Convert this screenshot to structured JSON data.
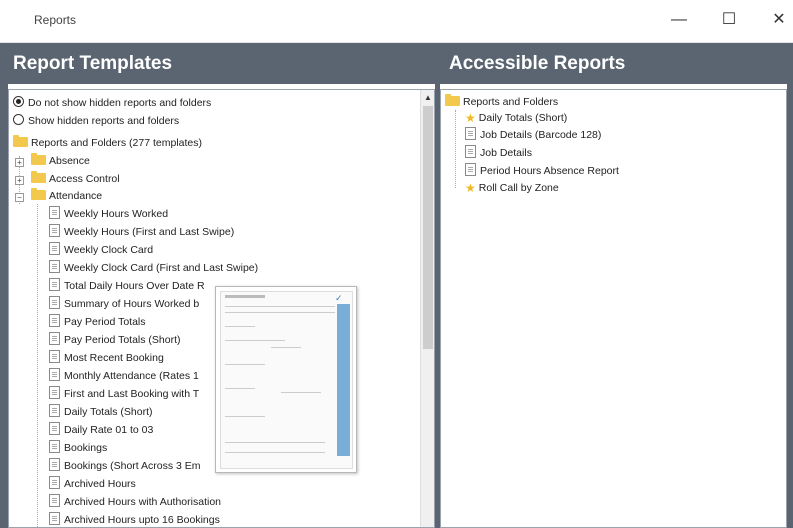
{
  "window": {
    "title": "Reports",
    "controls": {
      "minimize": "—",
      "maximize": "☐",
      "close": "✕"
    }
  },
  "left_panel": {
    "header": "Report Templates",
    "options": [
      {
        "label": "Do not show hidden reports and folders",
        "selected": true
      },
      {
        "label": "Show hidden reports and folders",
        "selected": false
      }
    ],
    "root_label": "Reports and Folders (277 templates)",
    "folders": [
      {
        "label": "Absence",
        "expander": "+"
      },
      {
        "label": "Access Control",
        "expander": "+"
      },
      {
        "label": "Attendance",
        "expander": "−"
      }
    ],
    "attendance_items": [
      "Weekly Hours Worked",
      "Weekly Hours (First and Last Swipe)",
      "Weekly Clock Card",
      "Weekly Clock Card (First and Last Swipe)",
      "Total Daily Hours Over Date R",
      "Summary of Hours Worked b",
      "Pay Period Totals",
      "Pay Period Totals (Short)",
      "Most Recent Booking",
      "Monthly Attendance (Rates 1",
      "First and Last Booking with T",
      "Daily Totals (Short)",
      "Daily Rate 01 to 03",
      "Bookings",
      "Bookings (Short Across 3 Em",
      "Archived Hours",
      "Archived Hours with Authorisation",
      "Archived Hours upto 16 Bookings"
    ],
    "scroll_up_icon": "▲"
  },
  "right_panel": {
    "header": "Accessible Reports",
    "root_label": "Reports and Folders",
    "items": [
      {
        "label": "Daily Totals (Short)",
        "icon": "star-icon"
      },
      {
        "label": "Job Details (Barcode 128)",
        "icon": "document-icon"
      },
      {
        "label": "Job Details",
        "icon": "document-icon"
      },
      {
        "label": "Period Hours Absence Report",
        "icon": "document-icon"
      },
      {
        "label": "Roll Call by Zone",
        "icon": "star-icon"
      }
    ]
  },
  "colors": {
    "header_bg": "#5b6571",
    "header_text": "#ffffff",
    "folder": "#f2c94c",
    "star": "#f0b923"
  }
}
